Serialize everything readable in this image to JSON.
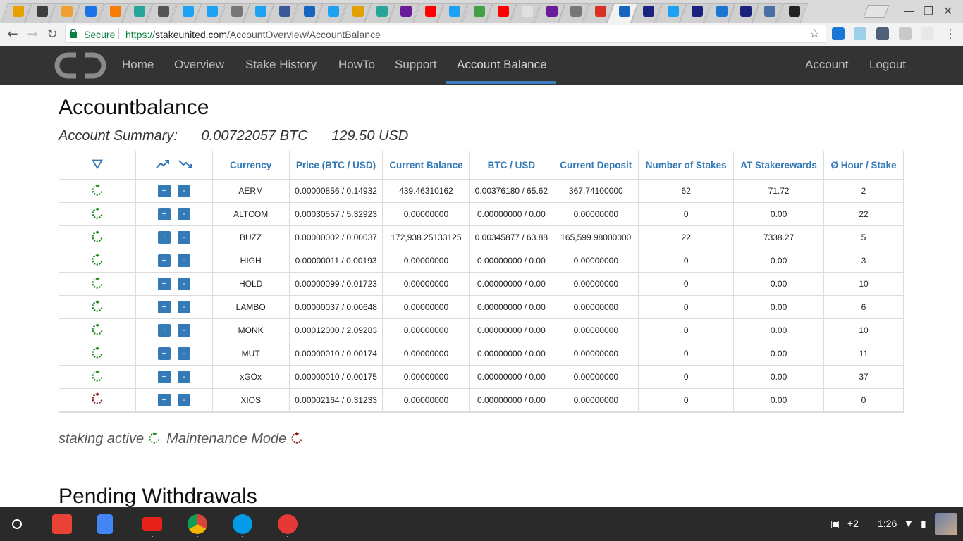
{
  "browser": {
    "secure_label": "Secure",
    "url_scheme": "https://",
    "url_host": "stakeunited.com",
    "url_path": "/AccountOverview/AccountBalance"
  },
  "navbar": {
    "links": [
      "Home",
      "Overview",
      "Stake History",
      "HowTo",
      "Support",
      "Account Balance"
    ],
    "right_links": [
      "Account",
      "Logout"
    ],
    "accent_color": "#3a7ec1"
  },
  "page": {
    "title": "Accountbalance",
    "summary_label": "Account Summary:",
    "summary_btc": "0.00722057 BTC",
    "summary_usd": "129.50 USD"
  },
  "table": {
    "headers": {
      "sort_icon": "triangle-down-icon",
      "trend_icons": [
        "trend-up-icon",
        "trend-down-icon"
      ],
      "currency": "Currency",
      "price": "Price (BTC / USD)",
      "balance": "Current Balance",
      "btc_usd": "BTC / USD",
      "deposit": "Current Deposit",
      "stakes": "Number of Stakes",
      "rewards": "AT Stakerewards",
      "hour_stake": "Ø Hour / Stake"
    },
    "plus_label": "+",
    "minus_label": "-",
    "rows": [
      {
        "status": "active",
        "currency": "AERM",
        "price": "0.00000856 / 0.14932",
        "balance": "439.46310162",
        "btc_usd": "0.00376180 / 65.62",
        "deposit": "367.74100000",
        "stakes": "62",
        "rewards": "71.72",
        "hour_stake": "2"
      },
      {
        "status": "active",
        "currency": "ALTCOM",
        "price": "0.00030557 / 5.32923",
        "balance": "0.00000000",
        "btc_usd": "0.00000000 / 0.00",
        "deposit": "0.00000000",
        "stakes": "0",
        "rewards": "0.00",
        "hour_stake": "22"
      },
      {
        "status": "active",
        "currency": "BUZZ",
        "price": "0.00000002 / 0.00037",
        "balance": "172,938.25133125",
        "btc_usd": "0.00345877 / 63.88",
        "deposit": "165,599.98000000",
        "stakes": "22",
        "rewards": "7338.27",
        "hour_stake": "5"
      },
      {
        "status": "active",
        "currency": "HIGH",
        "price": "0.00000011 / 0.00193",
        "balance": "0.00000000",
        "btc_usd": "0.00000000 / 0.00",
        "deposit": "0.00000000",
        "stakes": "0",
        "rewards": "0.00",
        "hour_stake": "3"
      },
      {
        "status": "active",
        "currency": "HOLD",
        "price": "0.00000099 / 0.01723",
        "balance": "0.00000000",
        "btc_usd": "0.00000000 / 0.00",
        "deposit": "0.00000000",
        "stakes": "0",
        "rewards": "0.00",
        "hour_stake": "10"
      },
      {
        "status": "active",
        "currency": "LAMBO",
        "price": "0.00000037 / 0.00648",
        "balance": "0.00000000",
        "btc_usd": "0.00000000 / 0.00",
        "deposit": "0.00000000",
        "stakes": "0",
        "rewards": "0.00",
        "hour_stake": "6"
      },
      {
        "status": "active",
        "currency": "MONK",
        "price": "0.00012000 / 2.09283",
        "balance": "0.00000000",
        "btc_usd": "0.00000000 / 0.00",
        "deposit": "0.00000000",
        "stakes": "0",
        "rewards": "0.00",
        "hour_stake": "10"
      },
      {
        "status": "active",
        "currency": "MUT",
        "price": "0.00000010 / 0.00174",
        "balance": "0.00000000",
        "btc_usd": "0.00000000 / 0.00",
        "deposit": "0.00000000",
        "stakes": "0",
        "rewards": "0.00",
        "hour_stake": "11"
      },
      {
        "status": "active",
        "currency": "xGOx",
        "price": "0.00000010 / 0.00175",
        "balance": "0.00000000",
        "btc_usd": "0.00000000 / 0.00",
        "deposit": "0.00000000",
        "stakes": "0",
        "rewards": "0.00",
        "hour_stake": "37"
      },
      {
        "status": "maintenance",
        "currency": "XIOS",
        "price": "0.00002164 / 0.31233",
        "balance": "0.00000000",
        "btc_usd": "0.00000000 / 0.00",
        "deposit": "0.00000000",
        "stakes": "0",
        "rewards": "0.00",
        "hour_stake": "0"
      }
    ]
  },
  "legend": {
    "active_label": "staking active",
    "maintenance_label": "Maintenance Mode",
    "active_color": "#1e8a1e",
    "maintenance_color": "#8b1a1a"
  },
  "pending": {
    "title": "Pending Withdrawals"
  },
  "system": {
    "notification_count": "+2",
    "time": "1:26"
  }
}
